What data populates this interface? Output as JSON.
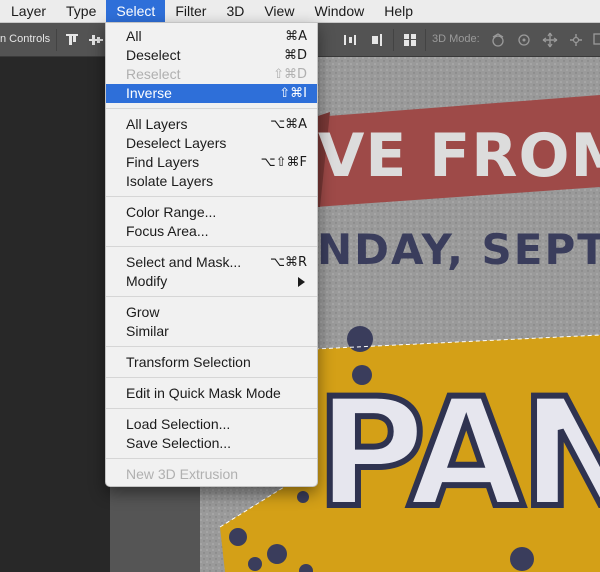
{
  "menubar": {
    "items": [
      {
        "label": "Layer"
      },
      {
        "label": "Type"
      },
      {
        "label": "Select"
      },
      {
        "label": "Filter"
      },
      {
        "label": "3D"
      },
      {
        "label": "View"
      },
      {
        "label": "Window"
      },
      {
        "label": "Help"
      }
    ]
  },
  "optionsbar": {
    "transform_controls_label": "n Controls",
    "mode3d_label": "3D Mode:"
  },
  "select_menu": {
    "items": [
      {
        "label": "All",
        "shortcut": "⌘A",
        "disabled": false
      },
      {
        "label": "Deselect",
        "shortcut": "⌘D",
        "disabled": false
      },
      {
        "label": "Reselect",
        "shortcut": "⇧⌘D",
        "disabled": true
      },
      {
        "label": "Inverse",
        "shortcut": "⇧⌘I",
        "disabled": false,
        "highlighted": true
      },
      {
        "label": "All Layers",
        "shortcut": "⌥⌘A",
        "disabled": false
      },
      {
        "label": "Deselect Layers",
        "shortcut": "",
        "disabled": false
      },
      {
        "label": "Find Layers",
        "shortcut": "⌥⇧⌘F",
        "disabled": false
      },
      {
        "label": "Isolate Layers",
        "shortcut": "",
        "disabled": false
      },
      {
        "label": "Color Range...",
        "shortcut": "",
        "disabled": false
      },
      {
        "label": "Focus Area...",
        "shortcut": "",
        "disabled": false
      },
      {
        "label": "Select and Mask...",
        "shortcut": "⌥⌘R",
        "disabled": false
      },
      {
        "label": "Modify",
        "shortcut": "",
        "disabled": false,
        "submenu": true
      },
      {
        "label": "Grow",
        "shortcut": "",
        "disabled": false
      },
      {
        "label": "Similar",
        "shortcut": "",
        "disabled": false
      },
      {
        "label": "Transform Selection",
        "shortcut": "",
        "disabled": false
      },
      {
        "label": "Edit in Quick Mask Mode",
        "shortcut": "",
        "disabled": false
      },
      {
        "label": "Load Selection...",
        "shortcut": "",
        "disabled": false
      },
      {
        "label": "Save Selection...",
        "shortcut": "",
        "disabled": false
      },
      {
        "label": "New 3D Extrusion",
        "shortcut": "",
        "disabled": true
      }
    ]
  },
  "canvas": {
    "banner_text": "VE FROM",
    "date_text": "NDAY, SEPTE",
    "title_text": "PAN"
  },
  "colors": {
    "menu_highlight": "#2e6fd9",
    "banner_red": "#9e4a48",
    "poster_yellow": "#d4a017",
    "poster_navy": "#3a3d5c"
  }
}
